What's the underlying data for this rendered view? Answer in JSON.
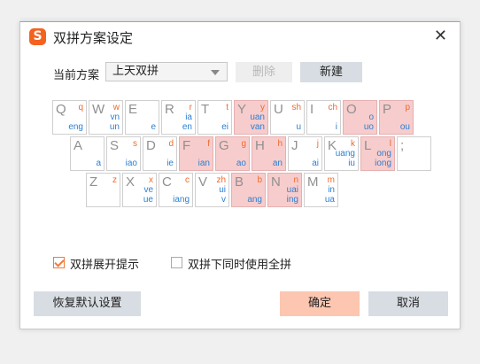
{
  "dialog": {
    "title": "双拼方案设定",
    "logo_text": "S"
  },
  "scheme": {
    "label": "当前方案",
    "selected": "上天双拼",
    "delete_label": "删除",
    "new_label": "新建"
  },
  "keys": {
    "Q": {
      "letter": "Q",
      "shengmu": "q",
      "yunmu": [
        "eng"
      ]
    },
    "W": {
      "letter": "W",
      "shengmu": "w",
      "yunmu": [
        "vn",
        "un"
      ]
    },
    "E": {
      "letter": "E",
      "shengmu": "",
      "yunmu": [
        "e"
      ]
    },
    "R": {
      "letter": "R",
      "shengmu": "r",
      "yunmu": [
        "ia",
        "en"
      ]
    },
    "T": {
      "letter": "T",
      "shengmu": "t",
      "yunmu": [
        "ei"
      ]
    },
    "Y": {
      "letter": "Y",
      "shengmu": "y",
      "yunmu": [
        "uan",
        "van"
      ]
    },
    "U": {
      "letter": "U",
      "shengmu": "sh",
      "yunmu": [
        "u"
      ]
    },
    "I": {
      "letter": "I",
      "shengmu": "ch",
      "yunmu": [
        "i"
      ]
    },
    "O": {
      "letter": "O",
      "shengmu": "",
      "yunmu": [
        "o",
        "uo"
      ]
    },
    "P": {
      "letter": "P",
      "shengmu": "p",
      "yunmu": [
        "ou"
      ]
    },
    "A": {
      "letter": "A",
      "shengmu": "",
      "yunmu": [
        "a"
      ]
    },
    "S": {
      "letter": "S",
      "shengmu": "s",
      "yunmu": [
        "iao"
      ]
    },
    "D": {
      "letter": "D",
      "shengmu": "d",
      "yunmu": [
        "ie"
      ]
    },
    "F": {
      "letter": "F",
      "shengmu": "f",
      "yunmu": [
        "ian"
      ]
    },
    "G": {
      "letter": "G",
      "shengmu": "g",
      "yunmu": [
        "ao"
      ]
    },
    "H": {
      "letter": "H",
      "shengmu": "h",
      "yunmu": [
        "an"
      ]
    },
    "J": {
      "letter": "J",
      "shengmu": "j",
      "yunmu": [
        "ai"
      ]
    },
    "K": {
      "letter": "K",
      "shengmu": "k",
      "yunmu": [
        "uang",
        "iu"
      ]
    },
    "L": {
      "letter": "L",
      "shengmu": "l",
      "yunmu": [
        "ong",
        "iong"
      ]
    },
    "SEMI": {
      "letter": ";",
      "shengmu": "",
      "yunmu": []
    },
    "Z": {
      "letter": "Z",
      "shengmu": "z",
      "yunmu": []
    },
    "X": {
      "letter": "X",
      "shengmu": "x",
      "yunmu": [
        "ve",
        "ue"
      ]
    },
    "C": {
      "letter": "C",
      "shengmu": "c",
      "yunmu": [
        "iang"
      ]
    },
    "V": {
      "letter": "V",
      "shengmu": "zh",
      "yunmu": [
        "ui",
        "v"
      ]
    },
    "B": {
      "letter": "B",
      "shengmu": "b",
      "yunmu": [
        "ang"
      ]
    },
    "N": {
      "letter": "N",
      "shengmu": "n",
      "yunmu": [
        "uai",
        "ing"
      ]
    },
    "M": {
      "letter": "M",
      "shengmu": "m",
      "yunmu": [
        "in",
        "ua"
      ]
    }
  },
  "highlighted_keys": [
    "Y",
    "O",
    "P",
    "F",
    "G",
    "H",
    "L",
    "B",
    "N"
  ],
  "options": {
    "expand_hint": {
      "label": "双拼展开提示",
      "checked": true
    },
    "use_quanpin": {
      "label": "双拼下同时使用全拼",
      "checked": false
    }
  },
  "buttons": {
    "restore": "恢复默认设置",
    "ok": "确定",
    "cancel": "取消"
  },
  "colors": {
    "accent": "#f06a2a",
    "yunmu": "#2a7fd4",
    "highlight_key": "#f7cccc",
    "ok_button": "#fcc6b0"
  }
}
